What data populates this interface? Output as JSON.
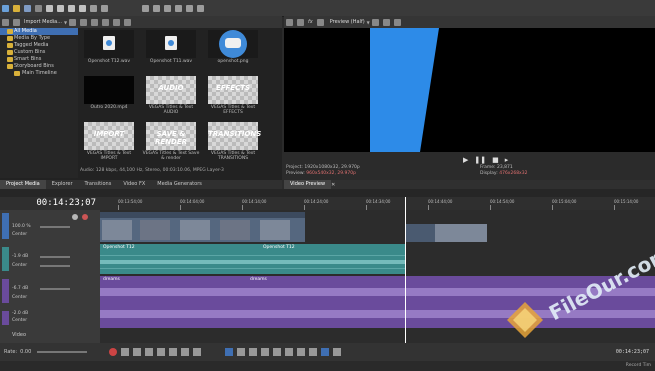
{
  "toolbar": {
    "media_dropdown": "Import Media..."
  },
  "media_tree": {
    "items": [
      "All Media",
      "Media By Type",
      "Tagged Media",
      "Custom Bins",
      "Smart Bins",
      "Storyboard Bins",
      "Main Timeline"
    ]
  },
  "media_grid": {
    "items": [
      {
        "caption": "Openshot T12.wav",
        "kind": "audio"
      },
      {
        "caption": "Openshot T11.wav",
        "kind": "audio"
      },
      {
        "caption": "openshot.png",
        "kind": "image"
      },
      {
        "caption": "Outro 2020.mp4",
        "kind": "video"
      },
      {
        "caption": "VEGAS Titles & Text AUDIO",
        "kind": "title",
        "word": "AUDIO"
      },
      {
        "caption": "VEGAS Titles & Text EFFECTS",
        "kind": "title",
        "word": "EFFECTS"
      },
      {
        "caption": "VEGAS Titles & Text IMPORT",
        "kind": "title",
        "word": "IMPORT"
      },
      {
        "caption": "VEGAS Titles & Text Save & render",
        "kind": "title",
        "word": "SAVE & RENDER"
      },
      {
        "caption": "VEGAS Titles & Text TRANSITIONS",
        "kind": "title",
        "word": "TRANSITIONS"
      }
    ],
    "status": "Audio: 128 kbps, 44,100 Hz, Stereo, 00:03:10.06, MPEG Layer-3"
  },
  "left_tabs": [
    "Project Media",
    "Explorer",
    "Transitions",
    "Video FX",
    "Media Generators"
  ],
  "preview": {
    "mode": "Preview (Half)",
    "project_label": "Project:",
    "project_value": "1920x1080x32, 29.970p",
    "preview_label": "Preview:",
    "preview_value": "960x540x32, 29.970p",
    "frame_label": "Frame:",
    "frame_value": "23,871",
    "display_label": "Display:",
    "display_value": "476x268x32",
    "tab": "Video Preview"
  },
  "timeline": {
    "timecode": "00:14:23;07",
    "ruler_marks": [
      "00:13:54;00",
      "00:14:04;00",
      "00:14:14;00",
      "00:14:24;00",
      "00:14:34;00",
      "00:14:44;00",
      "00:14:54;00",
      "00:15:04;00",
      "00:15:14;00"
    ],
    "clip_video_1": "Openshot T12",
    "clip_video_2": "Openshot T12",
    "clip_audio_1": "dreams",
    "clip_audio_2": "dreams",
    "track1_level": "100.0 %",
    "track1_fade": "Center",
    "track2_vol": "-1.9 dB",
    "track2_pan": "Center",
    "track3_vol": "-6.7 dB",
    "track3_pan": "Center",
    "track4_vol": "-2.0 dB",
    "track4_pan": "Center",
    "master_label": "Video",
    "rate_label": "Rate:",
    "rate_value": "0.00"
  },
  "bottom": {
    "timecode": "00:14:23;07",
    "record_time": "Record Tim"
  },
  "watermark": {
    "text": "FileOur.com"
  },
  "colors": {
    "accent": "#3f6fb3",
    "video_clip": "#55677f",
    "audio_teal": "#3a8a8a",
    "audio_purple": "#6a4b9c",
    "preview_blue": "#2d8be8"
  }
}
